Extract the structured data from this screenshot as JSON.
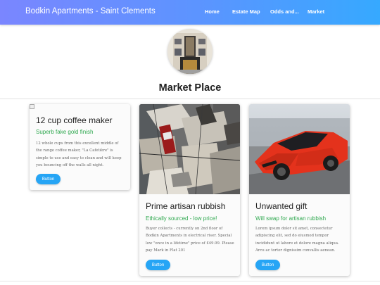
{
  "navbar": {
    "brand": "Bodkin Apartments - Saint Clements",
    "links": [
      "Home",
      "Estate Map",
      "Odds and...",
      "Market"
    ]
  },
  "page": {
    "title": "Market Place"
  },
  "cards": [
    {
      "title": "12 cup coffee maker",
      "subtitle": "Superb fake gold finish",
      "text": "12 whole cups from this excellent middle of the range coffee maker, \"La Cafetière\" is simple to use and easy to clean and will keep you bouncing off the walls all night.",
      "button": "Button"
    },
    {
      "title": "Prime artisan rubbish",
      "subtitle": "Ethically sourced - low price!",
      "text": "Buyer collects - currently on 2nd floor of Bodkin Apartments in electrical riser. Special low \"once in a lifetime\" price of £49.99. Please pay Mark in Flat 201",
      "button": "Button"
    },
    {
      "title": "Unwanted gift",
      "subtitle": "Will swap for artisan rubbish",
      "text": "Lorem ipsum dolor sit amet, consectetur adipiscing elit, sed do eiusmod tempor incididunt ut labore et dolore magna aliqua. Arcu ac tortor dignissim convallis aenean.",
      "button": "Button"
    }
  ],
  "colors": {
    "nav_gradient_start": "#7a86ff",
    "nav_gradient_end": "#36a9ff",
    "subtitle_green": "#2fa84f",
    "button_blue": "#26a5f5"
  },
  "icons": {
    "broken_image": "broken-image-icon"
  }
}
